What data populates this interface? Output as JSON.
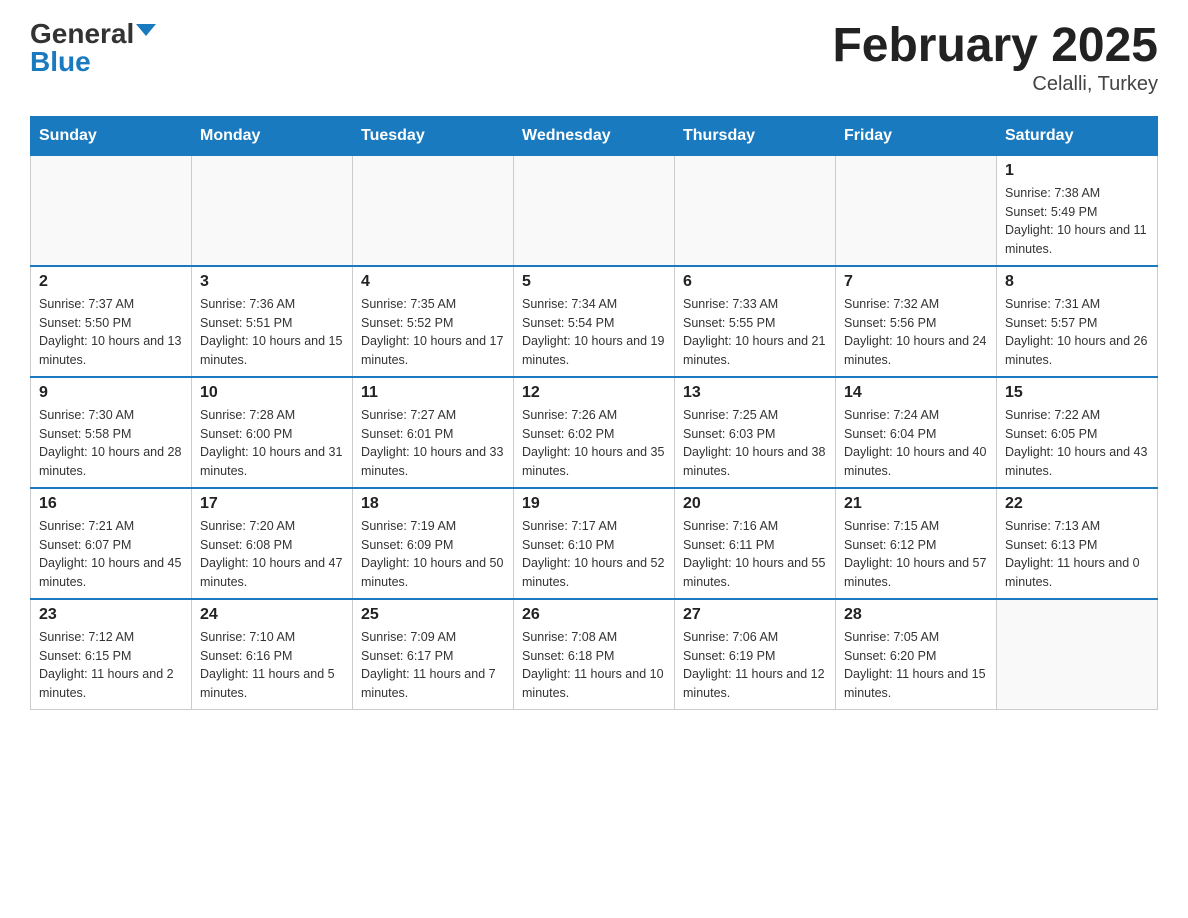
{
  "logo": {
    "general": "General",
    "blue": "Blue"
  },
  "title": "February 2025",
  "location": "Celalli, Turkey",
  "days_of_week": [
    "Sunday",
    "Monday",
    "Tuesday",
    "Wednesday",
    "Thursday",
    "Friday",
    "Saturday"
  ],
  "weeks": [
    [
      {
        "day": "",
        "info": ""
      },
      {
        "day": "",
        "info": ""
      },
      {
        "day": "",
        "info": ""
      },
      {
        "day": "",
        "info": ""
      },
      {
        "day": "",
        "info": ""
      },
      {
        "day": "",
        "info": ""
      },
      {
        "day": "1",
        "info": "Sunrise: 7:38 AM\nSunset: 5:49 PM\nDaylight: 10 hours and 11 minutes."
      }
    ],
    [
      {
        "day": "2",
        "info": "Sunrise: 7:37 AM\nSunset: 5:50 PM\nDaylight: 10 hours and 13 minutes."
      },
      {
        "day": "3",
        "info": "Sunrise: 7:36 AM\nSunset: 5:51 PM\nDaylight: 10 hours and 15 minutes."
      },
      {
        "day": "4",
        "info": "Sunrise: 7:35 AM\nSunset: 5:52 PM\nDaylight: 10 hours and 17 minutes."
      },
      {
        "day": "5",
        "info": "Sunrise: 7:34 AM\nSunset: 5:54 PM\nDaylight: 10 hours and 19 minutes."
      },
      {
        "day": "6",
        "info": "Sunrise: 7:33 AM\nSunset: 5:55 PM\nDaylight: 10 hours and 21 minutes."
      },
      {
        "day": "7",
        "info": "Sunrise: 7:32 AM\nSunset: 5:56 PM\nDaylight: 10 hours and 24 minutes."
      },
      {
        "day": "8",
        "info": "Sunrise: 7:31 AM\nSunset: 5:57 PM\nDaylight: 10 hours and 26 minutes."
      }
    ],
    [
      {
        "day": "9",
        "info": "Sunrise: 7:30 AM\nSunset: 5:58 PM\nDaylight: 10 hours and 28 minutes."
      },
      {
        "day": "10",
        "info": "Sunrise: 7:28 AM\nSunset: 6:00 PM\nDaylight: 10 hours and 31 minutes."
      },
      {
        "day": "11",
        "info": "Sunrise: 7:27 AM\nSunset: 6:01 PM\nDaylight: 10 hours and 33 minutes."
      },
      {
        "day": "12",
        "info": "Sunrise: 7:26 AM\nSunset: 6:02 PM\nDaylight: 10 hours and 35 minutes."
      },
      {
        "day": "13",
        "info": "Sunrise: 7:25 AM\nSunset: 6:03 PM\nDaylight: 10 hours and 38 minutes."
      },
      {
        "day": "14",
        "info": "Sunrise: 7:24 AM\nSunset: 6:04 PM\nDaylight: 10 hours and 40 minutes."
      },
      {
        "day": "15",
        "info": "Sunrise: 7:22 AM\nSunset: 6:05 PM\nDaylight: 10 hours and 43 minutes."
      }
    ],
    [
      {
        "day": "16",
        "info": "Sunrise: 7:21 AM\nSunset: 6:07 PM\nDaylight: 10 hours and 45 minutes."
      },
      {
        "day": "17",
        "info": "Sunrise: 7:20 AM\nSunset: 6:08 PM\nDaylight: 10 hours and 47 minutes."
      },
      {
        "day": "18",
        "info": "Sunrise: 7:19 AM\nSunset: 6:09 PM\nDaylight: 10 hours and 50 minutes."
      },
      {
        "day": "19",
        "info": "Sunrise: 7:17 AM\nSunset: 6:10 PM\nDaylight: 10 hours and 52 minutes."
      },
      {
        "day": "20",
        "info": "Sunrise: 7:16 AM\nSunset: 6:11 PM\nDaylight: 10 hours and 55 minutes."
      },
      {
        "day": "21",
        "info": "Sunrise: 7:15 AM\nSunset: 6:12 PM\nDaylight: 10 hours and 57 minutes."
      },
      {
        "day": "22",
        "info": "Sunrise: 7:13 AM\nSunset: 6:13 PM\nDaylight: 11 hours and 0 minutes."
      }
    ],
    [
      {
        "day": "23",
        "info": "Sunrise: 7:12 AM\nSunset: 6:15 PM\nDaylight: 11 hours and 2 minutes."
      },
      {
        "day": "24",
        "info": "Sunrise: 7:10 AM\nSunset: 6:16 PM\nDaylight: 11 hours and 5 minutes."
      },
      {
        "day": "25",
        "info": "Sunrise: 7:09 AM\nSunset: 6:17 PM\nDaylight: 11 hours and 7 minutes."
      },
      {
        "day": "26",
        "info": "Sunrise: 7:08 AM\nSunset: 6:18 PM\nDaylight: 11 hours and 10 minutes."
      },
      {
        "day": "27",
        "info": "Sunrise: 7:06 AM\nSunset: 6:19 PM\nDaylight: 11 hours and 12 minutes."
      },
      {
        "day": "28",
        "info": "Sunrise: 7:05 AM\nSunset: 6:20 PM\nDaylight: 11 hours and 15 minutes."
      },
      {
        "day": "",
        "info": ""
      }
    ]
  ]
}
